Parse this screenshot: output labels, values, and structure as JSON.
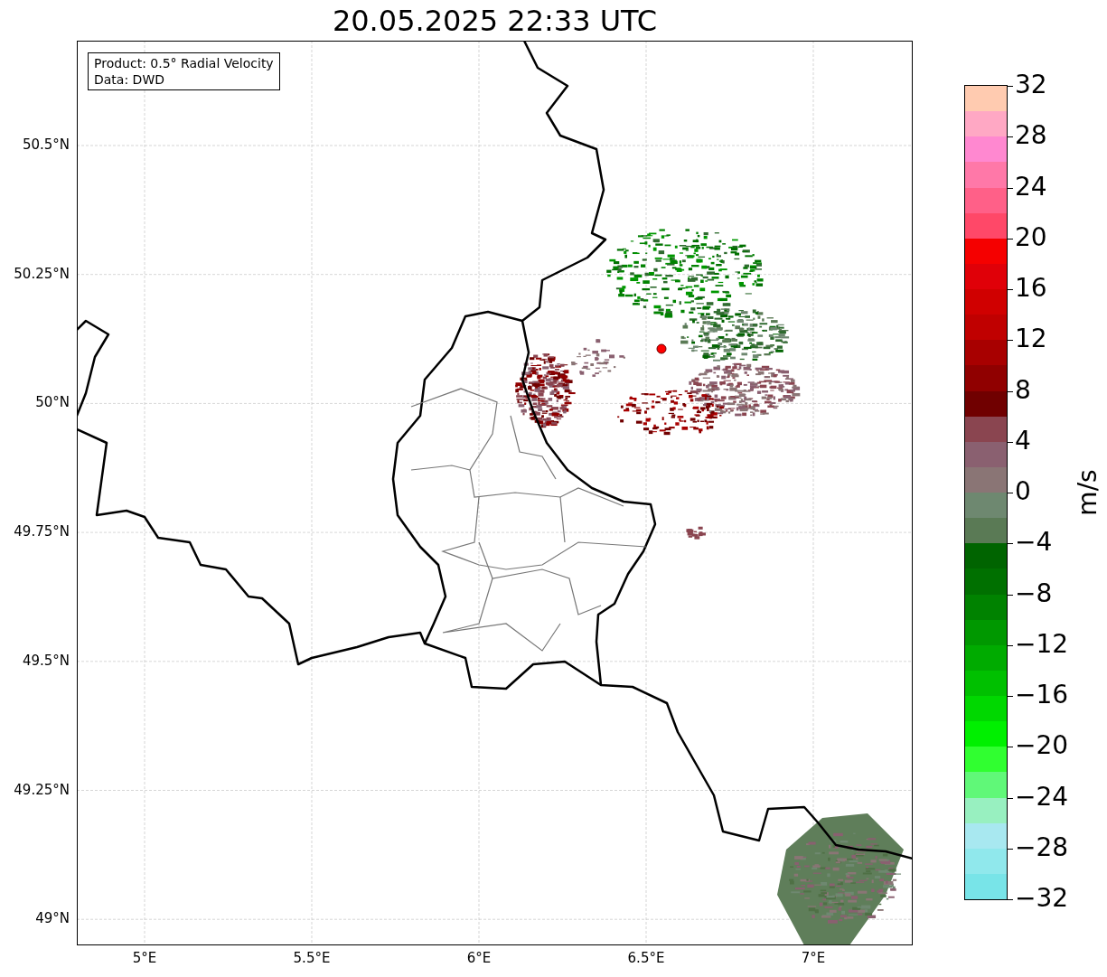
{
  "title": "20.05.2025 22:33 UTC",
  "legend": [
    "Product: 0.5° Radial Velocity",
    "Data: DWD"
  ],
  "y_ticks": [
    "50.5°N",
    "50.25°N",
    "50°N",
    "49.75°N",
    "49.5°N",
    "49.25°N",
    "49°N"
  ],
  "x_ticks": [
    "5°E",
    "5.5°E",
    "6°E",
    "6.5°E",
    "7°E"
  ],
  "colorbar": {
    "label": "m/s",
    "ticks": [
      "32",
      "28",
      "24",
      "20",
      "16",
      "12",
      "8",
      "4",
      "0",
      "−4",
      "−8",
      "−12",
      "−16",
      "−20",
      "−24",
      "−28",
      "−32"
    ],
    "segments": [
      {
        "color": "#ffcbb0"
      },
      {
        "color": "#ffa8c4"
      },
      {
        "color": "#ff88d0"
      },
      {
        "color": "#ff78a8"
      },
      {
        "color": "#ff6088"
      },
      {
        "color": "#ff4868"
      },
      {
        "color": "#f50000"
      },
      {
        "color": "#e00008"
      },
      {
        "color": "#d00000"
      },
      {
        "color": "#c00000"
      },
      {
        "color": "#a80000"
      },
      {
        "color": "#900000"
      },
      {
        "color": "#700000"
      },
      {
        "color": "#8a4550"
      },
      {
        "color": "#8a6070"
      },
      {
        "color": "#8a7575"
      },
      {
        "color": "#6e8870"
      },
      {
        "color": "#5a7a55"
      },
      {
        "color": "#006400"
      },
      {
        "color": "#007000"
      },
      {
        "color": "#008200"
      },
      {
        "color": "#009800"
      },
      {
        "color": "#00ab00"
      },
      {
        "color": "#00c000"
      },
      {
        "color": "#00d800"
      },
      {
        "color": "#00f000"
      },
      {
        "color": "#30ff30"
      },
      {
        "color": "#60f878"
      },
      {
        "color": "#98f0c0"
      },
      {
        "color": "#a8e8f0"
      },
      {
        "color": "#90e8ec"
      },
      {
        "color": "#78e4e8"
      }
    ]
  }
}
